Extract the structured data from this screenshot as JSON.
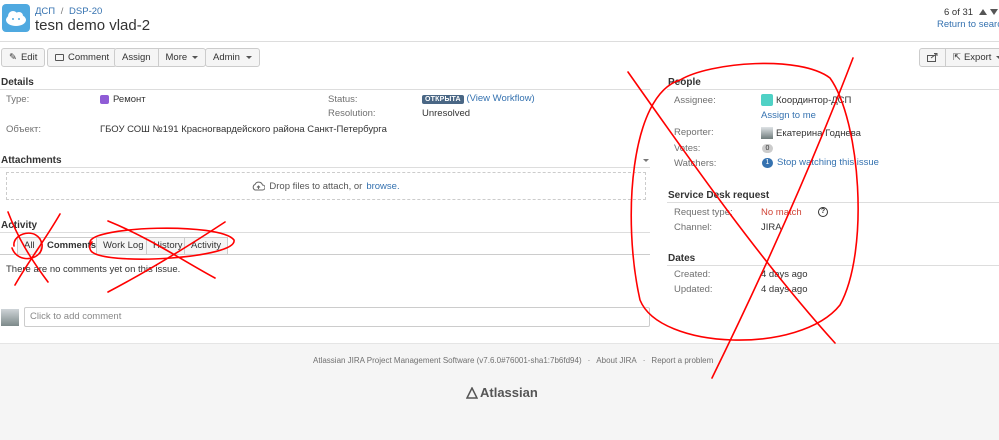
{
  "header": {
    "breadcrumb_project": "ДСП",
    "breadcrumb_sep": "/",
    "breadcrumb_key": "DSP-20",
    "title": "tesn demo vlad-2",
    "pager": "6 of 31",
    "return_link": "Return to search"
  },
  "toolbar": {
    "edit": "Edit",
    "comment": "Comment",
    "assign": "Assign",
    "more": "More",
    "admin": "Admin",
    "export": "Export"
  },
  "details": {
    "heading": "Details",
    "type_label": "Type:",
    "type_value": "Ремонт",
    "object_label": "Объект:",
    "object_value": "ГБОУ СОШ №191 Красногвардейского района Санкт-Петербурга",
    "status_label": "Status:",
    "status_value": "ОТКРЫТА",
    "workflow_link": "(View Workflow)",
    "resolution_label": "Resolution:",
    "resolution_value": "Unresolved"
  },
  "attachments": {
    "heading": "Attachments",
    "drop_text": "Drop files to attach, or",
    "browse": "browse."
  },
  "activity": {
    "heading": "Activity",
    "tabs": [
      "All",
      "Comments",
      "Work Log",
      "History",
      "Activity"
    ],
    "empty": "There are no comments yet on this issue.",
    "add_placeholder": "Click to add comment"
  },
  "people": {
    "heading": "People",
    "assignee_label": "Assignee:",
    "assignee_value": "Координтор-ДСП",
    "assign_to_me": "Assign to me",
    "reporter_label": "Reporter:",
    "reporter_value": "Екатерина Годнева",
    "votes_label": "Votes:",
    "votes_value": "0",
    "watchers_label": "Watchers:",
    "watchers_count": "1",
    "watchers_link": "Stop watching this issue"
  },
  "service_desk": {
    "heading": "Service Desk request",
    "request_type_label": "Request type:",
    "request_type_value": "No match",
    "channel_label": "Channel:",
    "channel_value": "JIRA"
  },
  "dates": {
    "heading": "Dates",
    "created_label": "Created:",
    "created_value": "4 days ago",
    "updated_label": "Updated:",
    "updated_value": "4 days ago"
  },
  "footer": {
    "software": "Atlassian JIRA Project Management Software (v7.6.0#76001-sha1:7b6fd94)",
    "dot": "·",
    "about": "About JIRA",
    "report": "Report a problem",
    "logo": "Atlassian"
  },
  "colors": {
    "link": "#3572b0",
    "annotation": "#ff0000",
    "status_badge": "#4a6785",
    "no_match": "#d04437"
  }
}
